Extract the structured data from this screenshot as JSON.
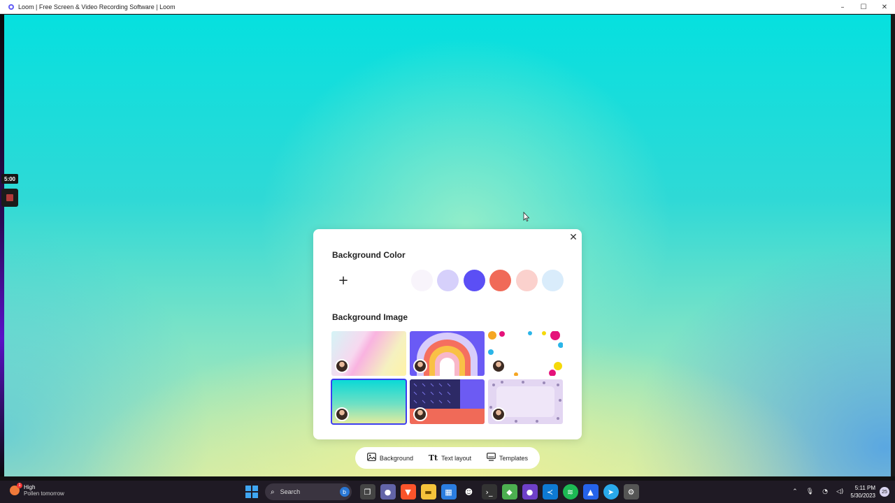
{
  "window": {
    "title": "Loom | Free Screen & Video Recording Software | Loom",
    "controls": [
      "–",
      "☐",
      "✕"
    ]
  },
  "recorder": {
    "timer": "5:00"
  },
  "panel": {
    "close": "✕",
    "background_color_title": "Background Color",
    "add_color": "+",
    "swatches": [
      "#ffffff",
      "#f8f4fb",
      "#d6d0fb",
      "#5b4ff5",
      "#f06a58",
      "#fbd1cd",
      "#d9ecfb"
    ],
    "background_image_title": "Background Image",
    "images": [
      {
        "name": "pastel-gradient",
        "selected": false
      },
      {
        "name": "rainbow-arch",
        "selected": false
      },
      {
        "name": "paint-splatter",
        "selected": false
      },
      {
        "name": "teal-yellow-gradient",
        "selected": true
      },
      {
        "name": "dot-grid-split",
        "selected": false
      },
      {
        "name": "lavender-flowers",
        "selected": false
      }
    ]
  },
  "tabs": [
    {
      "label": "Background",
      "icon": "image-icon"
    },
    {
      "label": "Text layout",
      "icon": "text-icon"
    },
    {
      "label": "Templates",
      "icon": "monitor-icon"
    }
  ],
  "taskbar": {
    "weather_main": "High",
    "weather_sub": "Pollen tomorrow",
    "search_placeholder": "Search",
    "time": "5:11 PM",
    "date": "5/30/2023",
    "notifications": "25"
  }
}
